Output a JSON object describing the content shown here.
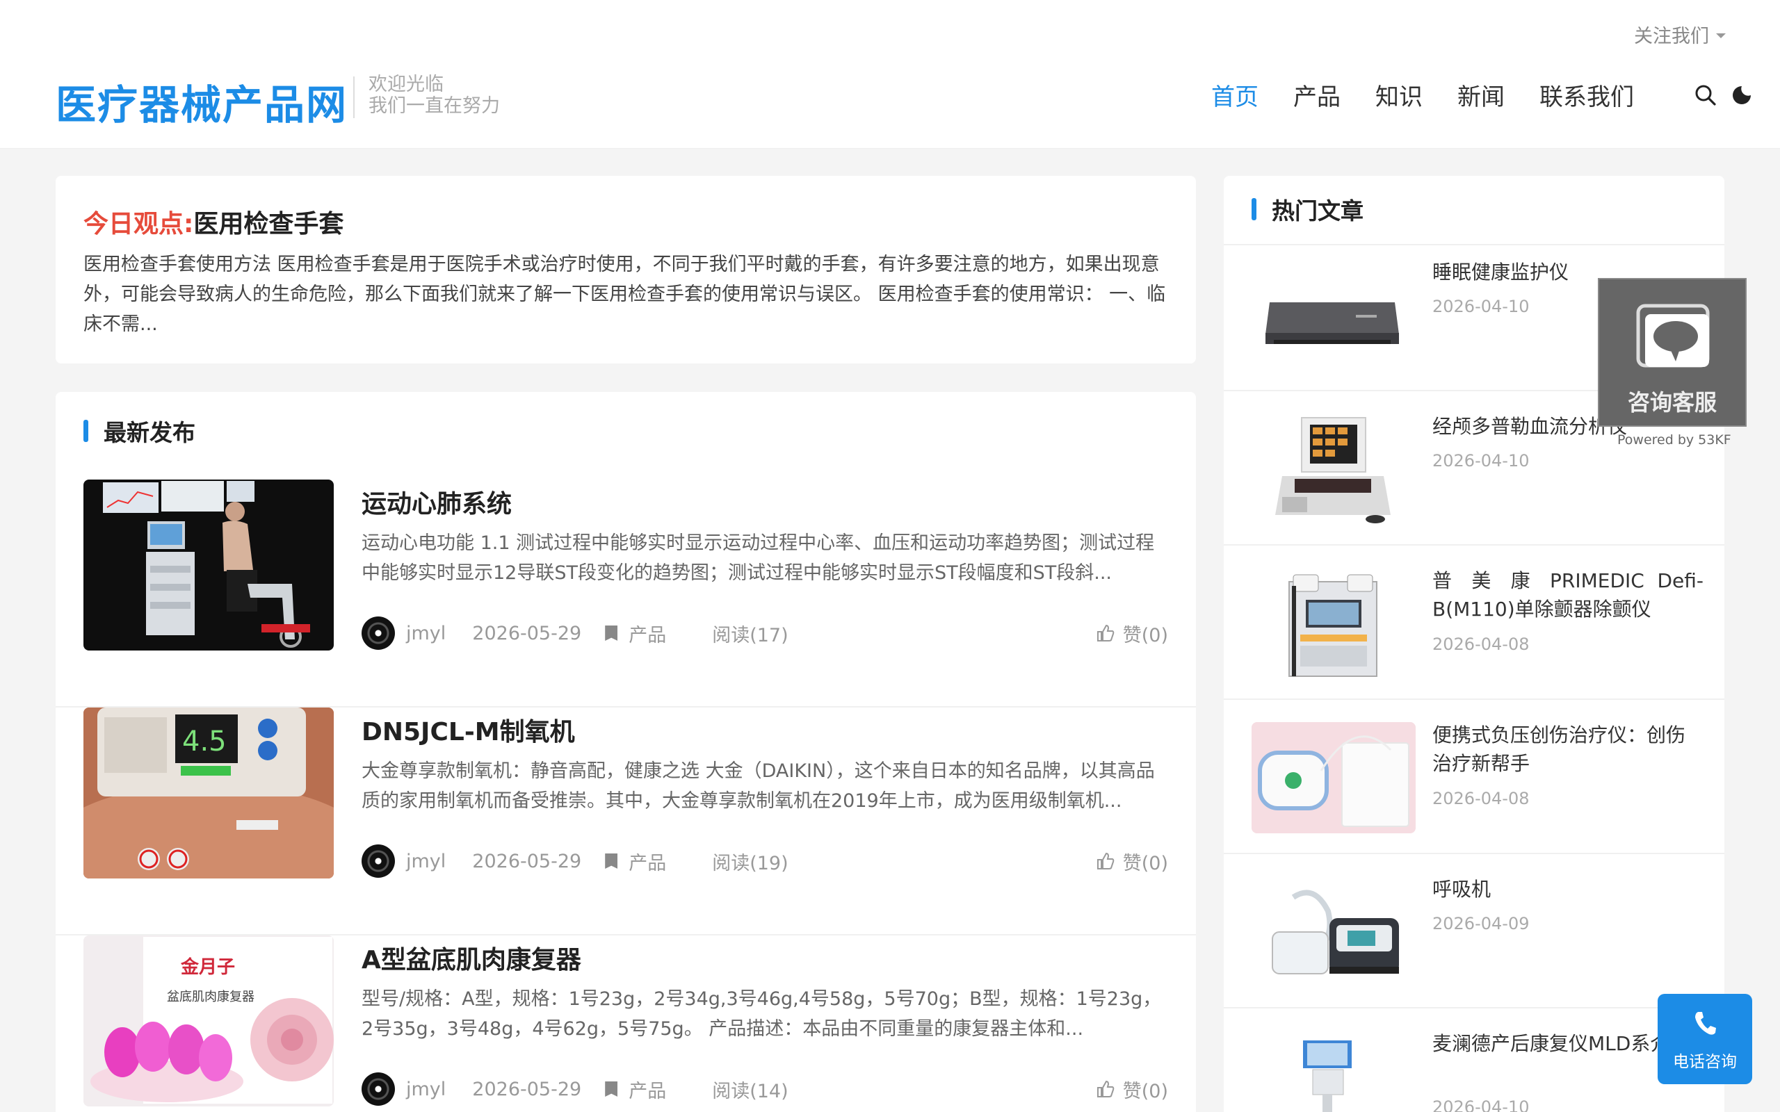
{
  "header": {
    "follow_label": "关注我们",
    "site_title": "医疗器械产品网",
    "slogan_line1": "欢迎光临",
    "slogan_line2": "我们一直在努力",
    "nav": [
      "首页",
      "产品",
      "知识",
      "新闻",
      "联系我们"
    ]
  },
  "today": {
    "label": "今日观点:",
    "title": "医用检查手套",
    "text": "医用检查手套使用方法 医用检查手套是用于医院手术或治疗时使用，不同于我们平时戴的手套，有许多要注意的地方，如果出现意外，可能会导致病人的生命危险，那么下面我们就来了解一下医用检查手套的使用常识与误区。 医用检查手套的使用常识： 一、临床不需..."
  },
  "latest": {
    "heading": "最新发布",
    "posts": [
      {
        "title": "运动心肺系统",
        "desc": "运动心电功能 1.1 测试过程中能够实时显示运动过程中心率、血压和运动功率趋势图；测试过程中能够实时显示12导联ST段变化的趋势图；测试过程中能够实时显示ST段幅度和ST段斜...",
        "author": "jmyl",
        "date": "2026-05-29",
        "category": "产品",
        "reads": "阅读(17)",
        "likes": "赞(0)"
      },
      {
        "title": "DN5JCL-M制氧机",
        "desc": "大金尊享款制氧机：静音高配，健康之选 大金（DAIKIN），这个来自日本的知名品牌，以其高品质的家用制氧机而备受推崇。其中，大金尊享款制氧机在2019年上市，成为医用级制氧机...",
        "author": "jmyl",
        "date": "2026-05-29",
        "category": "产品",
        "reads": "阅读(19)",
        "likes": "赞(0)",
        "display": "4.5"
      },
      {
        "title": "A型盆底肌肉康复器",
        "desc": "型号/规格：A型，规格：1号23g，2号34g,3号46g,4号58g，5号70g；B型，规格：1号23g，2号35g，3号48g，4号62g，5号75g。 产品描述：本品由不同重量的康复器主体和...",
        "author": "jmyl",
        "date": "2026-05-29",
        "category": "产品",
        "reads": "阅读(14)",
        "likes": "赞(0)",
        "brand": "金月子",
        "box_text": "盆底肌肉康复器"
      }
    ]
  },
  "hot": {
    "heading": "热门文章",
    "items": [
      {
        "title": "睡眠健康监护仪",
        "date": "2026-04-10"
      },
      {
        "title": "经颅多普勒血流分析仪",
        "date": "2026-04-10"
      },
      {
        "title": "普 美 康 PRIMEDIC Defi-B(M110)单除颤器除颤仪",
        "date": "2026-04-08"
      },
      {
        "title": "便携式负压创伤治疗仪：创伤治疗新帮手",
        "date": "2026-04-08"
      },
      {
        "title": "呼吸机",
        "date": "2026-04-09"
      },
      {
        "title": "麦澜德产后康复仪MLD系介绍",
        "date": "2026-04-10"
      }
    ]
  },
  "float": {
    "consult_label": "咨询客服",
    "powered_by": "Powered by 53KF",
    "phone_label": "电话咨询"
  },
  "colors": {
    "accent": "#1c8ce6",
    "highlight": "#e64b3b"
  }
}
